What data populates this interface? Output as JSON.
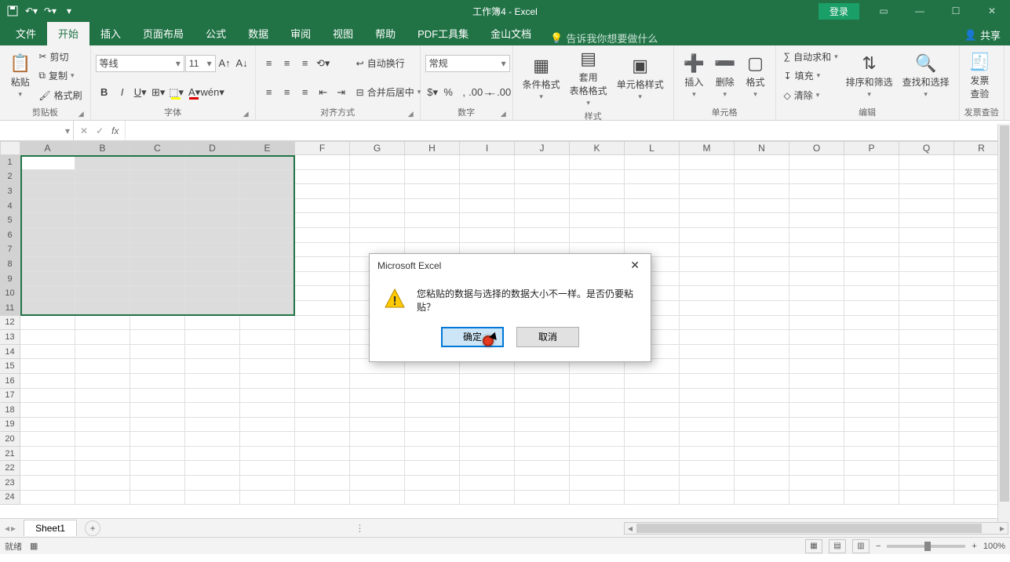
{
  "titlebar": {
    "title": "工作簿4 - Excel",
    "login": "登录"
  },
  "tabs": {
    "file": "文件",
    "home": "开始",
    "insert": "插入",
    "layout": "页面布局",
    "formulas": "公式",
    "data": "数据",
    "review": "审阅",
    "view": "视图",
    "help": "帮助",
    "pdf": "PDF工具集",
    "wps": "金山文档",
    "tellme": "告诉我你想要做什么",
    "share": "共享"
  },
  "ribbon": {
    "clipboard": {
      "paste": "粘贴",
      "cut": "剪切",
      "copy": "复制",
      "format_painter": "格式刷",
      "label": "剪贴板"
    },
    "font": {
      "name": "等线",
      "size": "11",
      "label": "字体"
    },
    "align": {
      "wrap": "自动换行",
      "merge": "合并后居中",
      "label": "对齐方式"
    },
    "number": {
      "format": "常规",
      "label": "数字"
    },
    "styles": {
      "cond": "条件格式",
      "table": "套用\n表格格式",
      "cell": "单元格样式",
      "label": "样式"
    },
    "cells": {
      "insert": "插入",
      "delete": "删除",
      "format": "格式",
      "label": "单元格"
    },
    "editing": {
      "sum": "自动求和",
      "fill": "填充",
      "clear": "清除",
      "sort": "排序和筛选",
      "find": "查找和选择",
      "label": "编辑"
    },
    "invoice": {
      "btn": "发票\n查验",
      "label": "发票查验"
    }
  },
  "formula_bar": {
    "namebox": "",
    "fx": "fx"
  },
  "columns": [
    "A",
    "B",
    "C",
    "D",
    "E",
    "F",
    "G",
    "H",
    "I",
    "J",
    "K",
    "L",
    "M",
    "N",
    "O",
    "P",
    "Q",
    "R"
  ],
  "selected_cols": [
    "A",
    "B",
    "C",
    "D",
    "E"
  ],
  "rows": [
    1,
    2,
    3,
    4,
    5,
    6,
    7,
    8,
    9,
    10,
    11,
    12,
    13,
    14,
    15,
    16,
    17,
    18,
    19,
    20,
    21,
    22,
    23,
    24
  ],
  "selected_rows": [
    1,
    2,
    3,
    4,
    5,
    6,
    7,
    8,
    9,
    10,
    11
  ],
  "dialog": {
    "title": "Microsoft Excel",
    "message": "您粘贴的数据与选择的数据大小不一样。是否仍要粘贴？",
    "ok": "确定",
    "cancel": "取消"
  },
  "sheetbar": {
    "sheet": "Sheet1"
  },
  "statusbar": {
    "status": "就绪",
    "zoom": "100%"
  }
}
